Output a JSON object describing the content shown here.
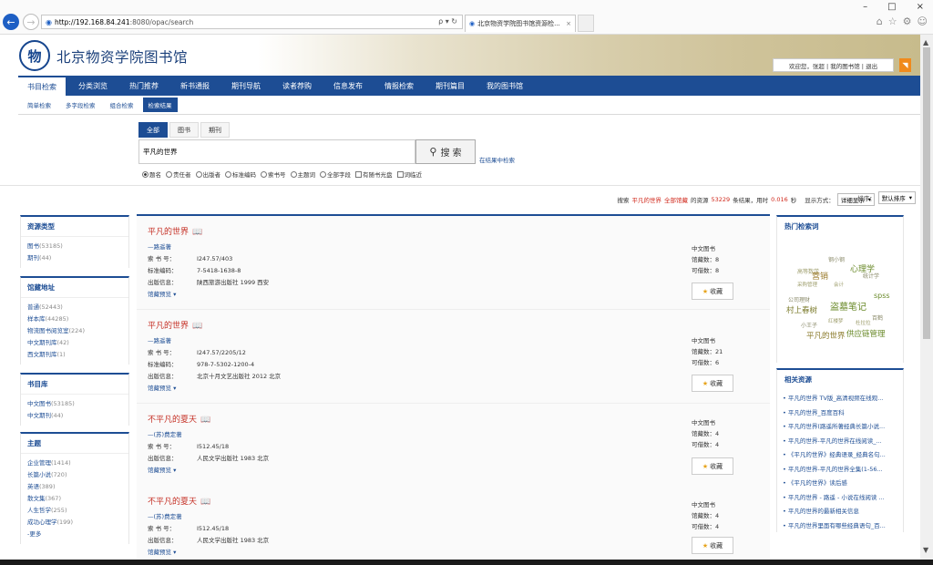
{
  "browser": {
    "url_host": "http://192.168.84.241",
    "url_rest": ":8080/opac/search",
    "addr_controls": "ρ ▾ ↻",
    "tab_title": "北京物资学院图书馆资源检...",
    "tab_close": "×",
    "win_min": "–",
    "win_max": "□",
    "win_close": "×",
    "back_icon": "←",
    "fwd_icon": "→",
    "home_icon": "⌂",
    "star_icon": "☆",
    "gear_icon": "⚙",
    "smiley_icon": "☺"
  },
  "header": {
    "library_name": "北京物资学院图书馆",
    "logo_glyph": "物",
    "welcome": "欢迎您，张超 | 我的图书馆 | 退出",
    "rss": "◥"
  },
  "main_nav": [
    "书目检索",
    "分类浏览",
    "热门推荐",
    "新书通报",
    "期刊导航",
    "读者荐购",
    "信息发布",
    "情报检索",
    "期刊篇目",
    "我的图书馆"
  ],
  "sub_nav": [
    "简单检索",
    "多字段检索",
    "组合检索",
    "检索结果"
  ],
  "search": {
    "tabs": [
      "全部",
      "图书",
      "期刊"
    ],
    "query": "平凡的世界",
    "button": "搜 索",
    "search_icon": "🔍",
    "in_results": "在结果中检索",
    "options": [
      "题名",
      "责任者",
      "出版者",
      "标准编码",
      "索书号",
      "主题词",
      "全部字段"
    ],
    "checks": [
      "有随书光盘",
      "词临近"
    ]
  },
  "stats": {
    "pre": "搜索",
    "query": "平凡的世界",
    "all_label": "全部馆藏",
    "mid": "的资源",
    "count": "53229",
    "post": "条结果，用时",
    "time": "0.016",
    "sec": "秒",
    "display_label": "显示方式：",
    "display_value": "详细显示",
    "sort_label": "排序：",
    "sort_value": "默认排序"
  },
  "facets": [
    {
      "title": "资源类型",
      "items": [
        {
          "name": "图书",
          "count": "(53185)"
        },
        {
          "name": "期刊",
          "count": "(44)"
        }
      ]
    },
    {
      "title": "馆藏地址",
      "items": [
        {
          "name": "普通",
          "count": "(52443)"
        },
        {
          "name": "样本库",
          "count": "(44285)"
        },
        {
          "name": "物流图书阅览室",
          "count": "(224)"
        },
        {
          "name": "中文期刊库",
          "count": "(42)"
        },
        {
          "name": "西文期刊库",
          "count": "(1)"
        }
      ]
    },
    {
      "title": "书目库",
      "items": [
        {
          "name": "中文图书",
          "count": "(53185)"
        },
        {
          "name": "中文期刊",
          "count": "(44)"
        }
      ]
    },
    {
      "title": "主题",
      "items": [
        {
          "name": "企业管理",
          "count": "(1414)"
        },
        {
          "name": "长篇小说",
          "count": "(720)"
        },
        {
          "name": "英语",
          "count": "(389)"
        },
        {
          "name": "散文集",
          "count": "(367)"
        },
        {
          "name": "人生哲学",
          "count": "(255)"
        },
        {
          "name": "成功心理学",
          "count": "(199)"
        },
        {
          "name": "更多",
          "count": ""
        }
      ]
    }
  ],
  "results": [
    {
      "title": "平凡的世界",
      "author": "路遥著",
      "call_label": "索 书 号：",
      "call": "I247.57/403",
      "isbn_label": "标准编码：",
      "isbn": "7-5418-1638-8",
      "pub_label": "出版信息：",
      "pub": "陕西旅游出版社  1999  西安",
      "preview": "馆藏预览 ▾",
      "type": "中文图书",
      "holdings": "馆藏数：8",
      "available": "可借数：8",
      "fav": "收藏"
    },
    {
      "title": "平凡的世界",
      "author": "路遥著",
      "call_label": "索 书 号：",
      "call": "I247.57/2205/12",
      "isbn_label": "标准编码：",
      "isbn": "978-7-5302-1200-4",
      "pub_label": "出版信息：",
      "pub": "北京十月文艺出版社  2012  北京",
      "preview": "馆藏预览 ▾",
      "type": "中文图书",
      "holdings": "馆藏数：21",
      "available": "可借数：6",
      "fav": "收藏"
    },
    {
      "title": "不平凡的夏天",
      "author": "(苏)费定著",
      "call_label": "索 书 号：",
      "call": "I512.45/18",
      "isbn_label": "",
      "isbn": "",
      "pub_label": "出版信息：",
      "pub": "人民文学出版社  1983  北京",
      "preview": "馆藏预览 ▾",
      "type": "中文图书",
      "holdings": "馆藏数：4",
      "available": "可借数：4",
      "fav": "收藏"
    },
    {
      "title": "不平凡的夏天",
      "author": "(苏)费定著",
      "call_label": "索 书 号：",
      "call": "I512.45/18",
      "isbn_label": "",
      "isbn": "",
      "pub_label": "出版信息：",
      "pub": "人民文学出版社  1983  北京",
      "preview": "馆藏预览 ▾",
      "type": "中文图书",
      "holdings": "馆藏数：4",
      "available": "可借数：4",
      "fav": "收藏"
    }
  ],
  "hot": {
    "title": "热门检索词",
    "words": [
      "钢小钢",
      "心理学",
      "高等数学",
      "统计学",
      "营销",
      "采购管理",
      "会计",
      "spss",
      "公司理财",
      "盗墓笔记",
      "村上春树",
      "红楼梦",
      "小王子",
      "杜拉拉",
      "百鹤",
      "平凡的世界",
      "供应链管理"
    ]
  },
  "related": {
    "title": "相关资源",
    "items": [
      "平凡的世界 TV版_高清视频在线观...",
      "平凡的世界_百度百科",
      "平凡的世界(路遥所著经典长篇小说...",
      "平凡的世界-平凡的世界在线阅读_...",
      "《平凡的世界》经典语录_经典名句...",
      "平凡的世界-平凡的世界全集(1-56...",
      "《平凡的世界》读后感",
      "平凡的世界 - 路遥 - 小说在线阅读 ...",
      "平凡的世界的最新相关信息",
      "平凡的世界里面有哪些经典语句_百..."
    ]
  },
  "colors": {
    "accent": "#1d4d94",
    "title_red": "#c53025",
    "star": "#e7a41c"
  }
}
